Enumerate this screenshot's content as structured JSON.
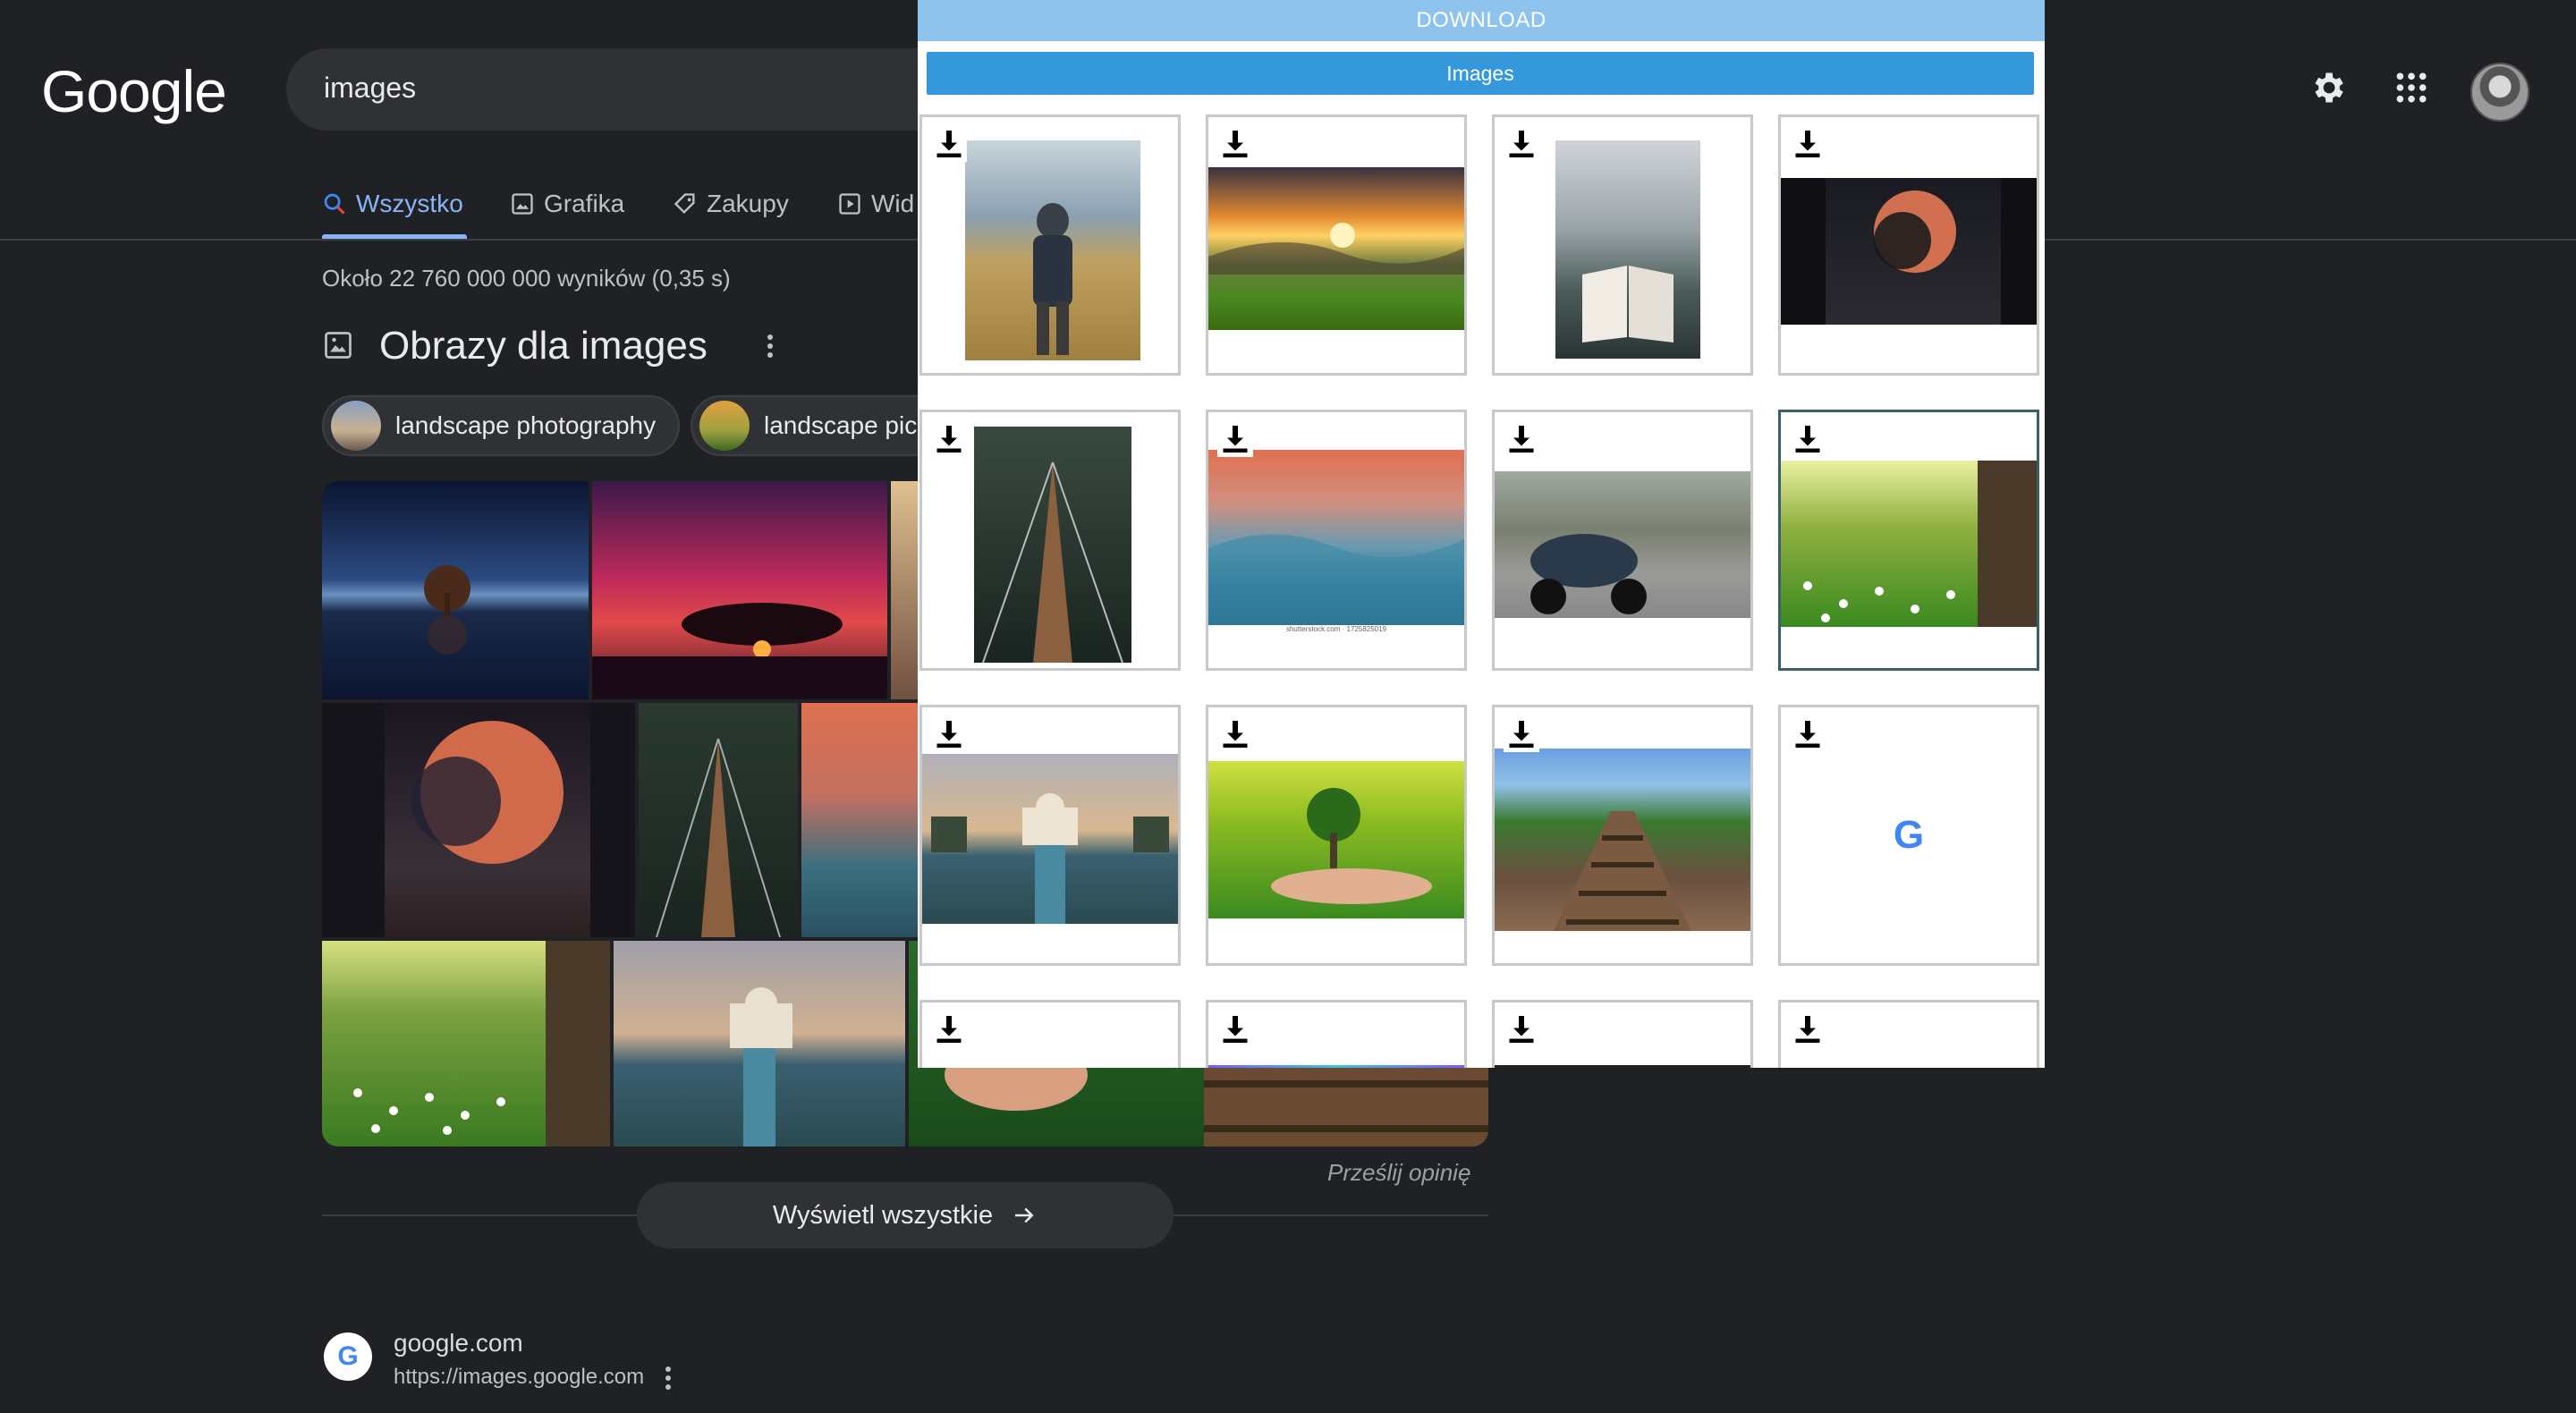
{
  "header": {
    "logo": "Google",
    "search_value": "images"
  },
  "tabs": [
    {
      "label": "Wszystko",
      "active": true
    },
    {
      "label": "Grafika"
    },
    {
      "label": "Zakupy"
    },
    {
      "label": "Wid"
    }
  ],
  "results": {
    "count_text": "Około 22 760 000 000 wyników (0,35 s)",
    "images_title": "Obrazy dla images",
    "chips": [
      "landscape photography",
      "landscape pic"
    ],
    "feedback": "Prześlij opinię",
    "view_all": "Wyświetl wszystkie"
  },
  "site_result": {
    "favicon": "G",
    "name": "google.com",
    "url": "https://images.google.com"
  },
  "popup": {
    "download_label": "DOWNLOAD",
    "images_button": "Images",
    "watermark": "shutterstock.com · 1725825019",
    "grid": [
      {
        "name": "man-in-field"
      },
      {
        "name": "sunset-valley"
      },
      {
        "name": "book-in-fog"
      },
      {
        "name": "moon-tree"
      },
      {
        "name": "forest-bridge"
      },
      {
        "name": "blue-mountains"
      },
      {
        "name": "scooter-road"
      },
      {
        "name": "meadow-flowers",
        "selected": true
      },
      {
        "name": "taj-mahal"
      },
      {
        "name": "tree-in-hand"
      },
      {
        "name": "railway-tracks"
      },
      {
        "name": "google-logo",
        "logo_text": "G"
      },
      {
        "name": "partial-1"
      },
      {
        "name": "partial-2"
      },
      {
        "name": "partial-3"
      },
      {
        "name": "partial-4"
      }
    ]
  },
  "colors": {
    "background": "#202124",
    "accent": "#8ab4f8",
    "popup_header": "#8ec3ee",
    "popup_button": "#3498db"
  }
}
